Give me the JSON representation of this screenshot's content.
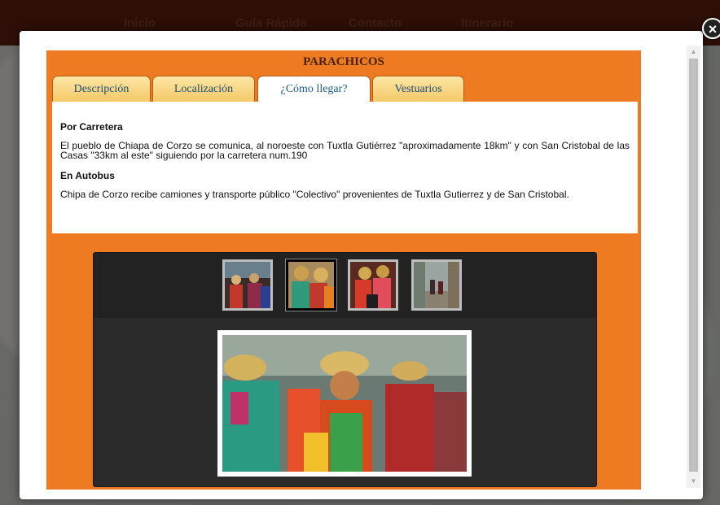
{
  "nav": {
    "items": [
      "Inicio",
      "Guía Rápida",
      "Contacto",
      "Itinerario"
    ]
  },
  "modal": {
    "close_glyph": "×",
    "title": "PARACHICOS",
    "tabs": [
      {
        "label": "Descripción"
      },
      {
        "label": "Localización"
      },
      {
        "label": "¿Cómo llegar?"
      },
      {
        "label": "Vestuarios"
      }
    ],
    "active_tab": "¿Cómo llegar?",
    "sections": [
      {
        "heading": "Por Carretera",
        "text": "El pueblo de Chiapa de Corzo se comunica, al noroeste con Tuxtla Gutiérrez \"aproximadamente 18km\" y con San Cristobal de las Casas \"33km al este\" siguiendo por la carretera num.190"
      },
      {
        "heading": "En Autobus",
        "text": "Chipa de Corzo recibe camiones y transporte público \"Colectivo\" provenientes de Tuxtla Gutierrez y de San Cristobal."
      }
    ],
    "gallery": {
      "thumbnail_count": 4,
      "selected_index": 1
    }
  },
  "colors": {
    "tab_text": "#1b5b88",
    "title": "#4a2307",
    "content_bg": "#ee7a22"
  }
}
